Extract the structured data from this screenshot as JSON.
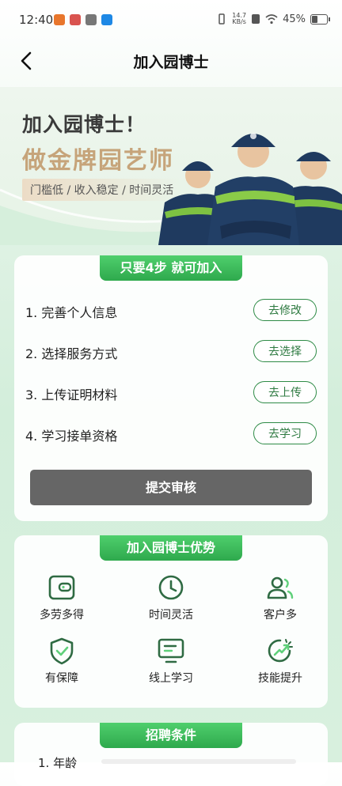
{
  "status": {
    "time": "12:40",
    "net_speed_top": "14.7",
    "net_speed_bottom": "KB/s",
    "battery": "45%",
    "battery_level": 0.45
  },
  "nav": {
    "title": "加入园博士"
  },
  "banner": {
    "title": "加入园博士！",
    "subtitle": "做金牌园艺师",
    "tags": "门槛低 / 收入稳定 / 时间灵活"
  },
  "steps": {
    "header": "只要4步 就可加入",
    "items": [
      {
        "label": "1. 完善个人信息",
        "action": "去修改"
      },
      {
        "label": "2. 选择服务方式",
        "action": "去选择"
      },
      {
        "label": "3. 上传证明材料",
        "action": "去上传"
      },
      {
        "label": "4. 学习接单资格",
        "action": "去学习"
      }
    ],
    "submit": "提交审核"
  },
  "advantages": {
    "header": "加入园博士优势",
    "items": [
      {
        "label": "多劳多得",
        "icon": "wallet-icon"
      },
      {
        "label": "时间灵活",
        "icon": "clock-icon"
      },
      {
        "label": "客户多",
        "icon": "users-icon"
      },
      {
        "label": "有保障",
        "icon": "shield-check-icon"
      },
      {
        "label": "线上学习",
        "icon": "monitor-icon"
      },
      {
        "label": "技能提升",
        "icon": "growth-icon"
      }
    ]
  },
  "requirements": {
    "header": "招聘条件",
    "first_item": "1. 年龄"
  },
  "colors": {
    "accent": "#2ea94d",
    "icon": "#2f6b43",
    "submit_bg": "#666666",
    "gold": "#c6a47a"
  }
}
